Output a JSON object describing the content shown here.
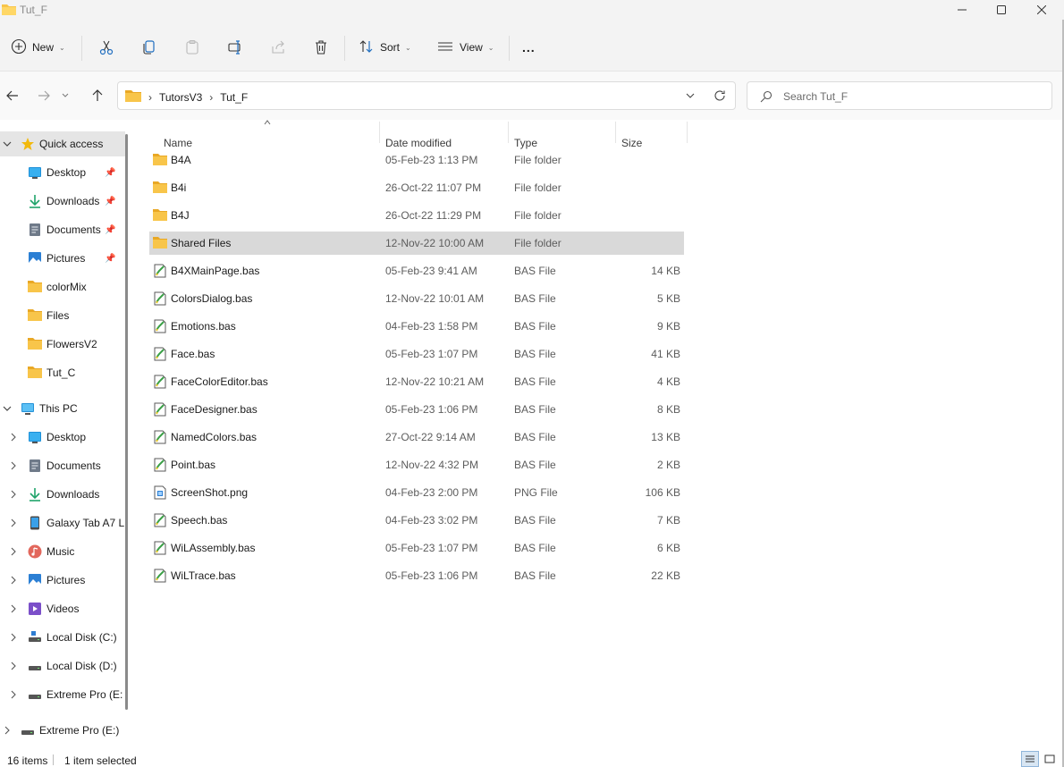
{
  "window": {
    "title": "Tut_F"
  },
  "toolbar": {
    "new_label": "New",
    "sort_label": "Sort",
    "view_label": "View",
    "more_label": "..."
  },
  "address": {
    "crumbs": [
      "TutorsV3",
      "Tut_F"
    ]
  },
  "search": {
    "placeholder": "Search Tut_F"
  },
  "columns": {
    "name": "Name",
    "date": "Date modified",
    "type": "Type",
    "size": "Size"
  },
  "sidebar": {
    "quick_access": {
      "label": "Quick access",
      "items": [
        {
          "label": "Desktop",
          "icon": "desktop-icon",
          "pinned": true
        },
        {
          "label": "Downloads",
          "icon": "download-icon",
          "pinned": true
        },
        {
          "label": "Documents",
          "icon": "documents-icon",
          "pinned": true
        },
        {
          "label": "Pictures",
          "icon": "pictures-icon",
          "pinned": true
        },
        {
          "label": "colorMix",
          "icon": "folder-icon",
          "pinned": false
        },
        {
          "label": "Files",
          "icon": "folder-icon",
          "pinned": false
        },
        {
          "label": "FlowersV2",
          "icon": "folder-icon",
          "pinned": false
        },
        {
          "label": "Tut_C",
          "icon": "folder-icon",
          "pinned": false
        }
      ]
    },
    "this_pc": {
      "label": "This PC",
      "items": [
        {
          "label": "Desktop",
          "icon": "desktop-icon"
        },
        {
          "label": "Documents",
          "icon": "documents-icon"
        },
        {
          "label": "Downloads",
          "icon": "download-icon"
        },
        {
          "label": "Galaxy Tab A7 L",
          "icon": "tablet-icon"
        },
        {
          "label": "Music",
          "icon": "music-icon"
        },
        {
          "label": "Pictures",
          "icon": "pictures-icon"
        },
        {
          "label": "Videos",
          "icon": "videos-icon"
        },
        {
          "label": "Local Disk (C:)",
          "icon": "drive-icon"
        },
        {
          "label": "Local Disk (D:)",
          "icon": "drive-icon"
        },
        {
          "label": "Extreme Pro (E:",
          "icon": "drive-icon"
        }
      ]
    },
    "extreme_pro": {
      "label": "Extreme Pro (E:)",
      "icon": "drive-icon"
    }
  },
  "files": [
    {
      "name": "B4A",
      "date": "05-Feb-23 1:13 PM",
      "type": "File folder",
      "size": "",
      "icon": "folder-icon"
    },
    {
      "name": "B4i",
      "date": "26-Oct-22 11:07 PM",
      "type": "File folder",
      "size": "",
      "icon": "folder-icon"
    },
    {
      "name": "B4J",
      "date": "26-Oct-22 11:29 PM",
      "type": "File folder",
      "size": "",
      "icon": "folder-icon"
    },
    {
      "name": "Shared Files",
      "date": "12-Nov-22 10:00 AM",
      "type": "File folder",
      "size": "",
      "icon": "folder-icon",
      "selected": true
    },
    {
      "name": "B4XMainPage.bas",
      "date": "05-Feb-23 9:41 AM",
      "type": "BAS File",
      "size": "14 KB",
      "icon": "bas-file-icon"
    },
    {
      "name": "ColorsDialog.bas",
      "date": "12-Nov-22 10:01 AM",
      "type": "BAS File",
      "size": "5 KB",
      "icon": "bas-file-icon"
    },
    {
      "name": "Emotions.bas",
      "date": "04-Feb-23 1:58 PM",
      "type": "BAS File",
      "size": "9 KB",
      "icon": "bas-file-icon"
    },
    {
      "name": "Face.bas",
      "date": "05-Feb-23 1:07 PM",
      "type": "BAS File",
      "size": "41 KB",
      "icon": "bas-file-icon"
    },
    {
      "name": "FaceColorEditor.bas",
      "date": "12-Nov-22 10:21 AM",
      "type": "BAS File",
      "size": "4 KB",
      "icon": "bas-file-icon"
    },
    {
      "name": "FaceDesigner.bas",
      "date": "05-Feb-23 1:06 PM",
      "type": "BAS File",
      "size": "8 KB",
      "icon": "bas-file-icon"
    },
    {
      "name": "NamedColors.bas",
      "date": "27-Oct-22 9:14 AM",
      "type": "BAS File",
      "size": "13 KB",
      "icon": "bas-file-icon"
    },
    {
      "name": "Point.bas",
      "date": "12-Nov-22 4:32 PM",
      "type": "BAS File",
      "size": "2 KB",
      "icon": "bas-file-icon"
    },
    {
      "name": "ScreenShot.png",
      "date": "04-Feb-23 2:00 PM",
      "type": "PNG File",
      "size": "106 KB",
      "icon": "png-file-icon"
    },
    {
      "name": "Speech.bas",
      "date": "04-Feb-23 3:02 PM",
      "type": "BAS File",
      "size": "7 KB",
      "icon": "bas-file-icon"
    },
    {
      "name": "WiLAssembly.bas",
      "date": "05-Feb-23 1:07 PM",
      "type": "BAS File",
      "size": "6 KB",
      "icon": "bas-file-icon"
    },
    {
      "name": "WiLTrace.bas",
      "date": "05-Feb-23 1:06 PM",
      "type": "BAS File",
      "size": "22 KB",
      "icon": "bas-file-icon"
    }
  ],
  "status": {
    "count": "16 items",
    "selection": "1 item selected"
  },
  "colors": {
    "folder": "#f8c54a",
    "accent": "#0067c0",
    "selection": "#d9d9d9",
    "star": "#f2b90c"
  }
}
